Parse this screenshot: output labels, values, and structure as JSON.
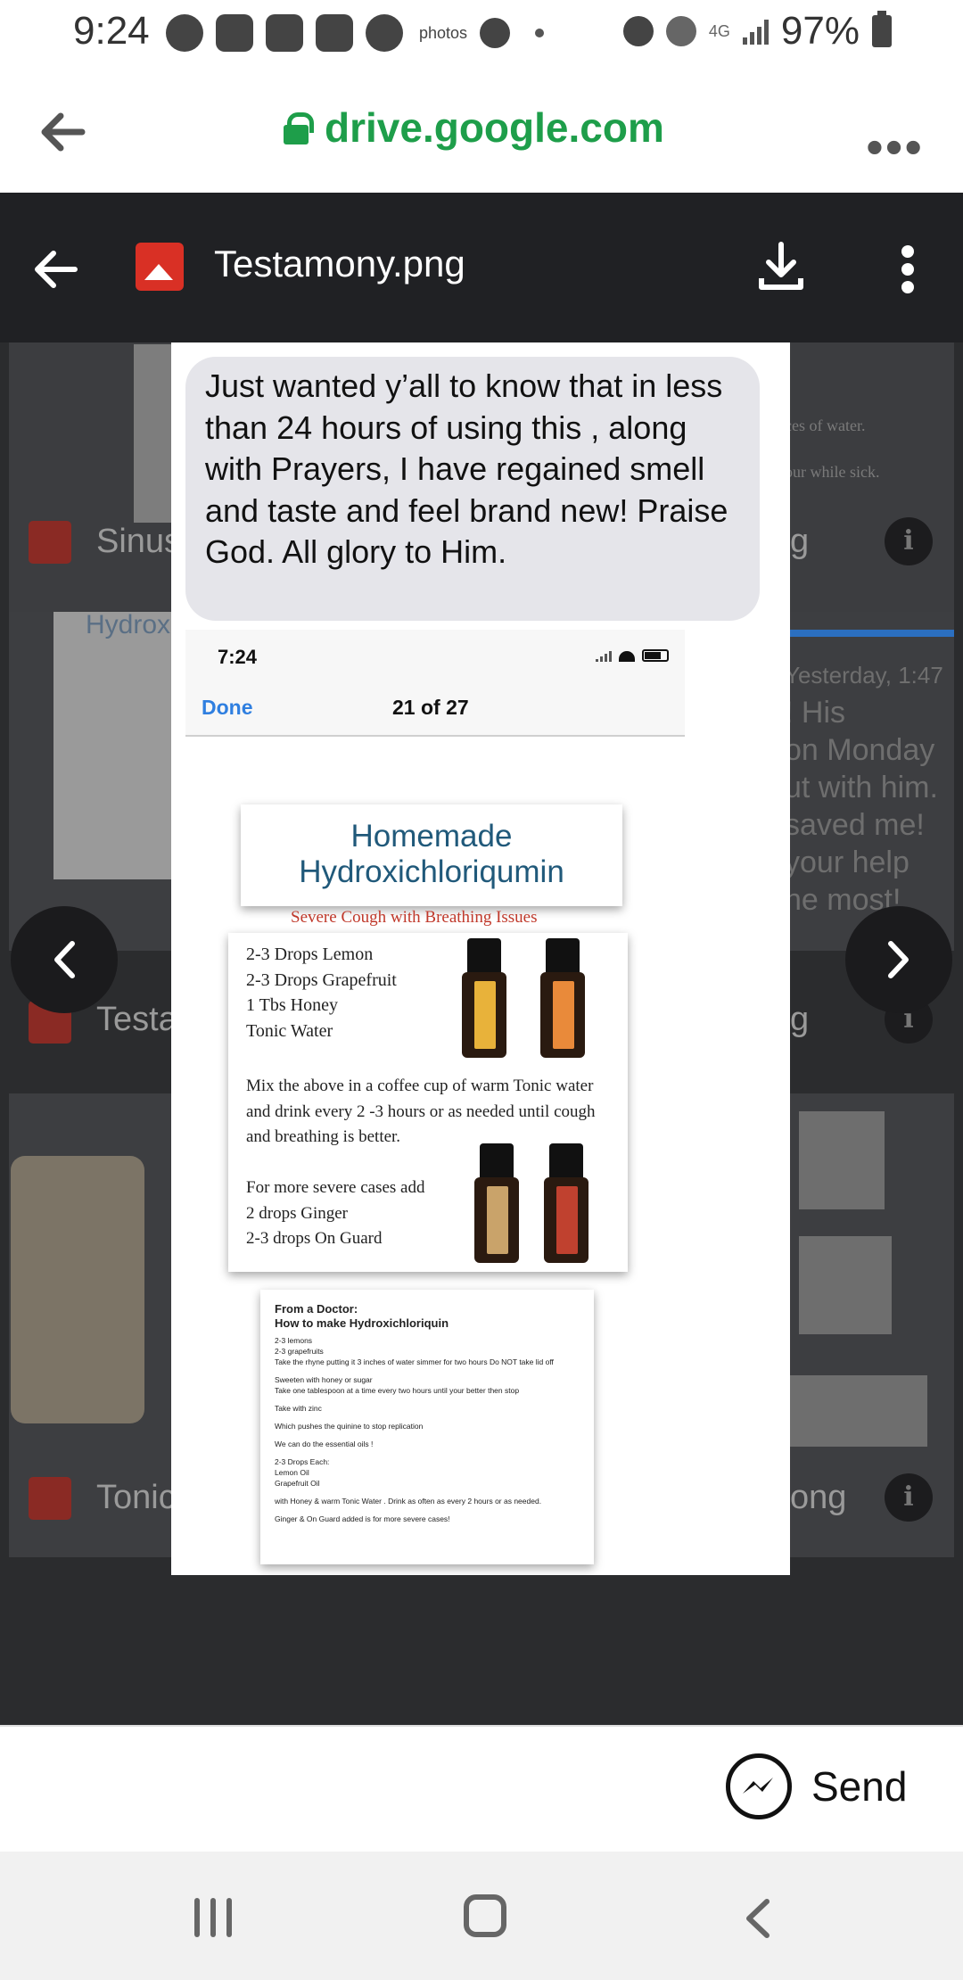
{
  "status_bar": {
    "time": "9:24",
    "photos_label": "photos",
    "network_label": "4G",
    "battery": "97%"
  },
  "browser": {
    "url": "drive.google.com"
  },
  "drive_header": {
    "file_name": "Testamony.png"
  },
  "background_files": {
    "item1_label": "Sinus",
    "item1_suffix": "g",
    "item2_label": "Testa",
    "item2_suffix": "g",
    "item3_label": "Tonic",
    "item3_suffix": "ong",
    "hydrox_partial": "Hydrox",
    "right_text": [
      "Yesterday, 1:47",
      "! His",
      "on Monday",
      "ut with him.",
      "saved me!",
      "your help",
      "he most!"
    ],
    "top_right_text": [
      "ces of water.",
      "our while sick."
    ]
  },
  "preview": {
    "message": "Just wanted y’all to know that in less than 24 hours of using this , along with Prayers, I have regained smell and taste and feel brand new! Praise God. All glory to Him.",
    "phone_time": "7:24",
    "done_label": "Done",
    "page_counter": "21 of 27",
    "card_title": "Homemade Hydroxichloriqumin",
    "card_subtitle": "Severe Cough with Breathing Issues",
    "ingredients": [
      "2-3 Drops Lemon",
      "2-3 Drops Grapefruit",
      "1 Tbs Honey",
      "Tonic Water"
    ],
    "mix_text": "Mix the above in a coffee cup of warm Tonic water and drink every 2 -3 hours or as needed until cough and breathing is better.",
    "severe_text": [
      "For more severe cases add",
      "2 drops Ginger",
      "2-3 drops On Guard"
    ],
    "bottle_labels": [
      "Lemon",
      "Grapefruit",
      "Ginger",
      "On Guard"
    ],
    "doc_title_1": "From a Doctor:",
    "doc_title_2": "How to make Hydroxichloriquin",
    "doc_lines": [
      "2-3 lemons",
      "2-3 grapefruits",
      "Take the rhyne putting it 3 inches of water simmer for two hours Do NOT take lid off",
      "",
      "Sweeten with honey or sugar",
      "Take one tablespoon at a time every two hours until your better then stop",
      "",
      "Take with zinc",
      "",
      "Which pushes the quinine to stop replication",
      "",
      "We can do the essential oils !",
      "",
      "2-3 Drops Each:",
      "Lemon Oil",
      "Grapefruit Oil",
      "",
      "with Honey & warm Tonic Water . Drink as often as every 2 hours or as needed.",
      "",
      "Ginger & On Guard added is for more severe cases!"
    ]
  },
  "send_bar": {
    "send_label": "Send"
  },
  "colors": {
    "url_green": "#1e9e4a",
    "title_blue": "#20597a",
    "subtitle_red": "#c0392b",
    "ios_blue": "#2f7fe0",
    "bubble_gray": "#e5e5ea"
  }
}
